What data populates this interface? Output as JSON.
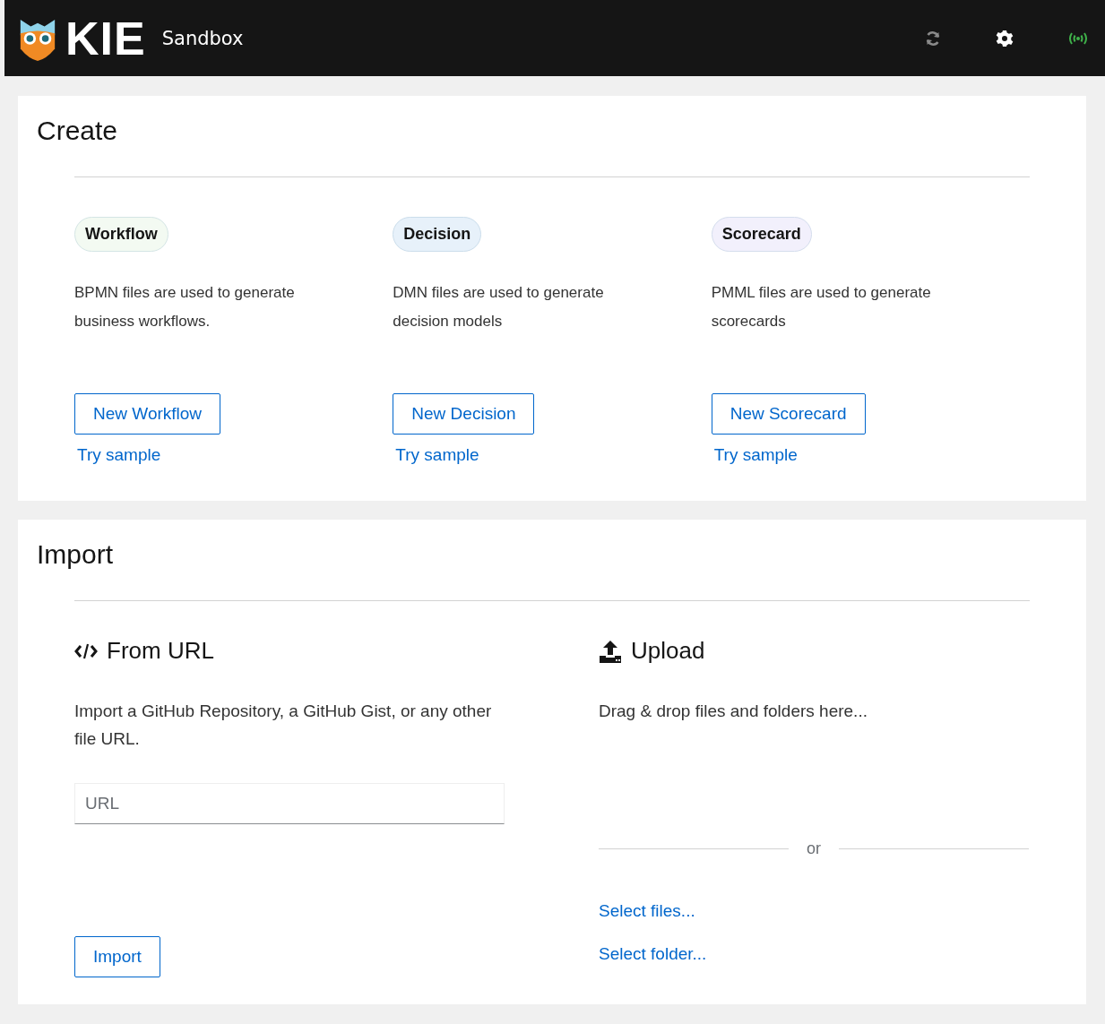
{
  "header": {
    "logo": "KIE",
    "product": "Sandbox"
  },
  "create": {
    "title": "Create",
    "cards": [
      {
        "badge": "Workflow",
        "color": "#f3faf2",
        "description": "BPMN files are used to generate business workflows.",
        "button": "New Workflow",
        "link": "Try sample"
      },
      {
        "badge": "Decision",
        "color": "#e7f1fa",
        "description": "DMN files are used to generate decision models",
        "button": "New Decision",
        "link": "Try sample"
      },
      {
        "badge": "Scorecard",
        "color": "#f2f0fc",
        "description": "PMML files are used to generate scorecards",
        "button": "New Scorecard",
        "link": "Try sample"
      }
    ]
  },
  "import": {
    "title": "Import",
    "from_url": {
      "title": "From URL",
      "description": "Import a GitHub Repository, a GitHub Gist, or any other file URL.",
      "placeholder": "URL",
      "button": "Import"
    },
    "upload": {
      "title": "Upload",
      "description": "Drag & drop files and folders here...",
      "separator": "or",
      "links": [
        "Select files...",
        "Select folder..."
      ]
    }
  }
}
